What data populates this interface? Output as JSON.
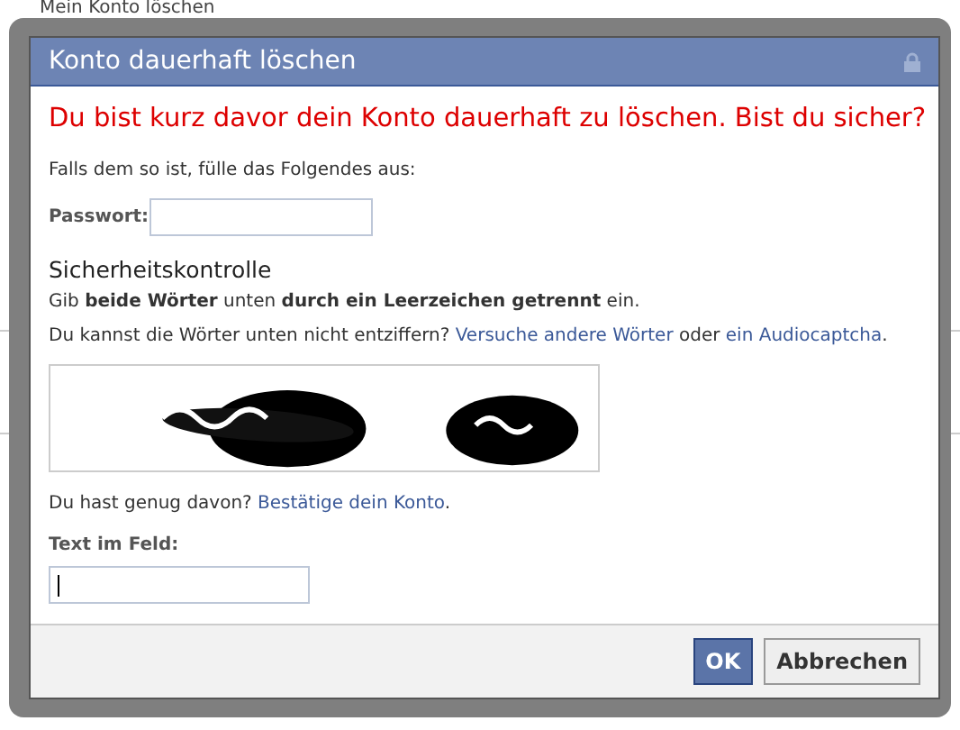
{
  "background": {
    "title": "Mein Konto löschen"
  },
  "dialog": {
    "title": "Konto dauerhaft löschen",
    "warning": "Du bist kurz davor dein Konto dauerhaft zu löschen. Bist du sicher?",
    "intro": "Falls dem so ist, fülle das Folgendes aus:",
    "password": {
      "label": "Passwort:"
    },
    "security": {
      "heading": "Sicherheitskontrolle",
      "instruction": "Gib **beide Wörter** unten **durch ein Leerzeichen getrennt** ein.",
      "help": {
        "text": "Du kannst die Wörter unten nicht entziffern?",
        "link1": "Versuche andere Wörter",
        "middle": "oder",
        "link2": "ein Audiocaptcha",
        "end": "."
      },
      "enough": {
        "text": "Du hast genug davon?",
        "link": "Bestätige dein Konto",
        "end": "."
      },
      "field": {
        "label": "Text im Feld:",
        "focused": true
      }
    },
    "buttons": [
      {
        "label": "OK",
        "kind": "primary"
      },
      {
        "label": "Abbrechen",
        "kind": "secondary"
      }
    ]
  }
}
